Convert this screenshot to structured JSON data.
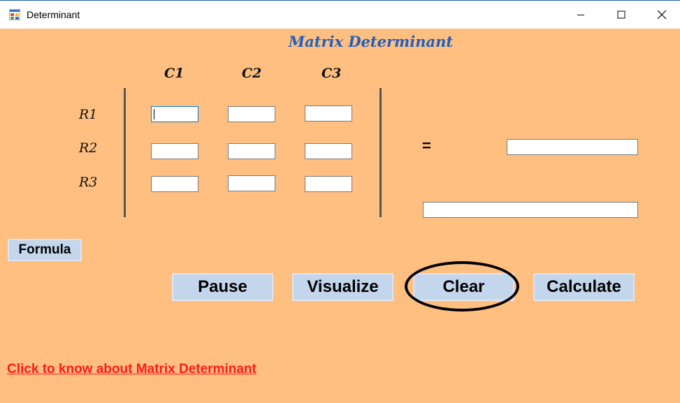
{
  "window": {
    "title": "Determinant",
    "app_icon": "winforms-app-icon",
    "controls": {
      "minimize": "minimize-icon",
      "maximize": "maximize-icon",
      "close": "close-icon"
    }
  },
  "main": {
    "heading": "Matrix Determinant",
    "columns": [
      "C1",
      "C2",
      "C3"
    ],
    "rows": [
      "R1",
      "R2",
      "R3"
    ],
    "cells": [
      [
        "",
        "",
        ""
      ],
      [
        "",
        "",
        ""
      ],
      [
        "",
        "",
        ""
      ]
    ],
    "equals_sign": "=",
    "result_value": "",
    "formula_output": ""
  },
  "buttons": {
    "formula": "Formula",
    "pause": "Pause",
    "visualize": "Visualize",
    "clear": "Clear",
    "calculate": "Calculate"
  },
  "link": {
    "text": "Click to know about Matrix Determinant",
    "color": "#ff1a1a"
  },
  "colors": {
    "background": "#ffbf80",
    "heading": "#1f5fc0",
    "button": "#c3d6ec"
  }
}
